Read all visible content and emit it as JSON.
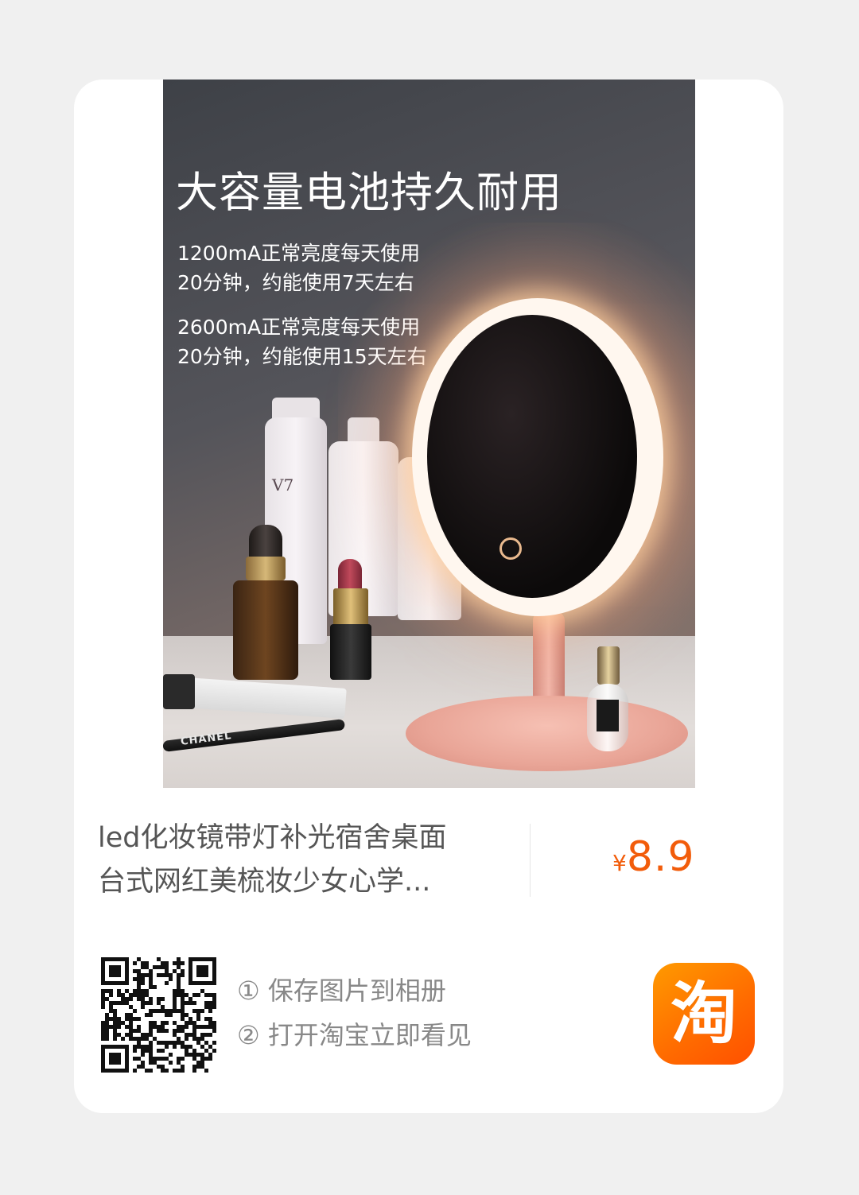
{
  "product_image": {
    "headline": "大容量电池持久耐用",
    "spec_1": [
      "1200mA正常亮度每天使用",
      "20分钟，约能使用7天左右"
    ],
    "spec_2": [
      "2600mA正常亮度每天使用",
      "20分钟，约能使用15天左右"
    ],
    "bottle_label": "V7",
    "pencil_brand": "CHANEL"
  },
  "product": {
    "title_lines": [
      "led化妆镜带灯补光宿舍桌面",
      "台式网红美梳妆少女心学..."
    ],
    "price_symbol": "¥",
    "price": "8.9"
  },
  "share": {
    "steps": [
      "① 保存图片到相册",
      "② 打开淘宝立即看见"
    ],
    "app_logo_char": "淘",
    "qr_icon": "qr-code-icon",
    "app_icon": "taobao-app-icon"
  },
  "colors": {
    "price": "#f25c0a",
    "app_logo": "#ff6a00",
    "card_background": "#ffffff",
    "page_background": "#f0f0f0"
  }
}
